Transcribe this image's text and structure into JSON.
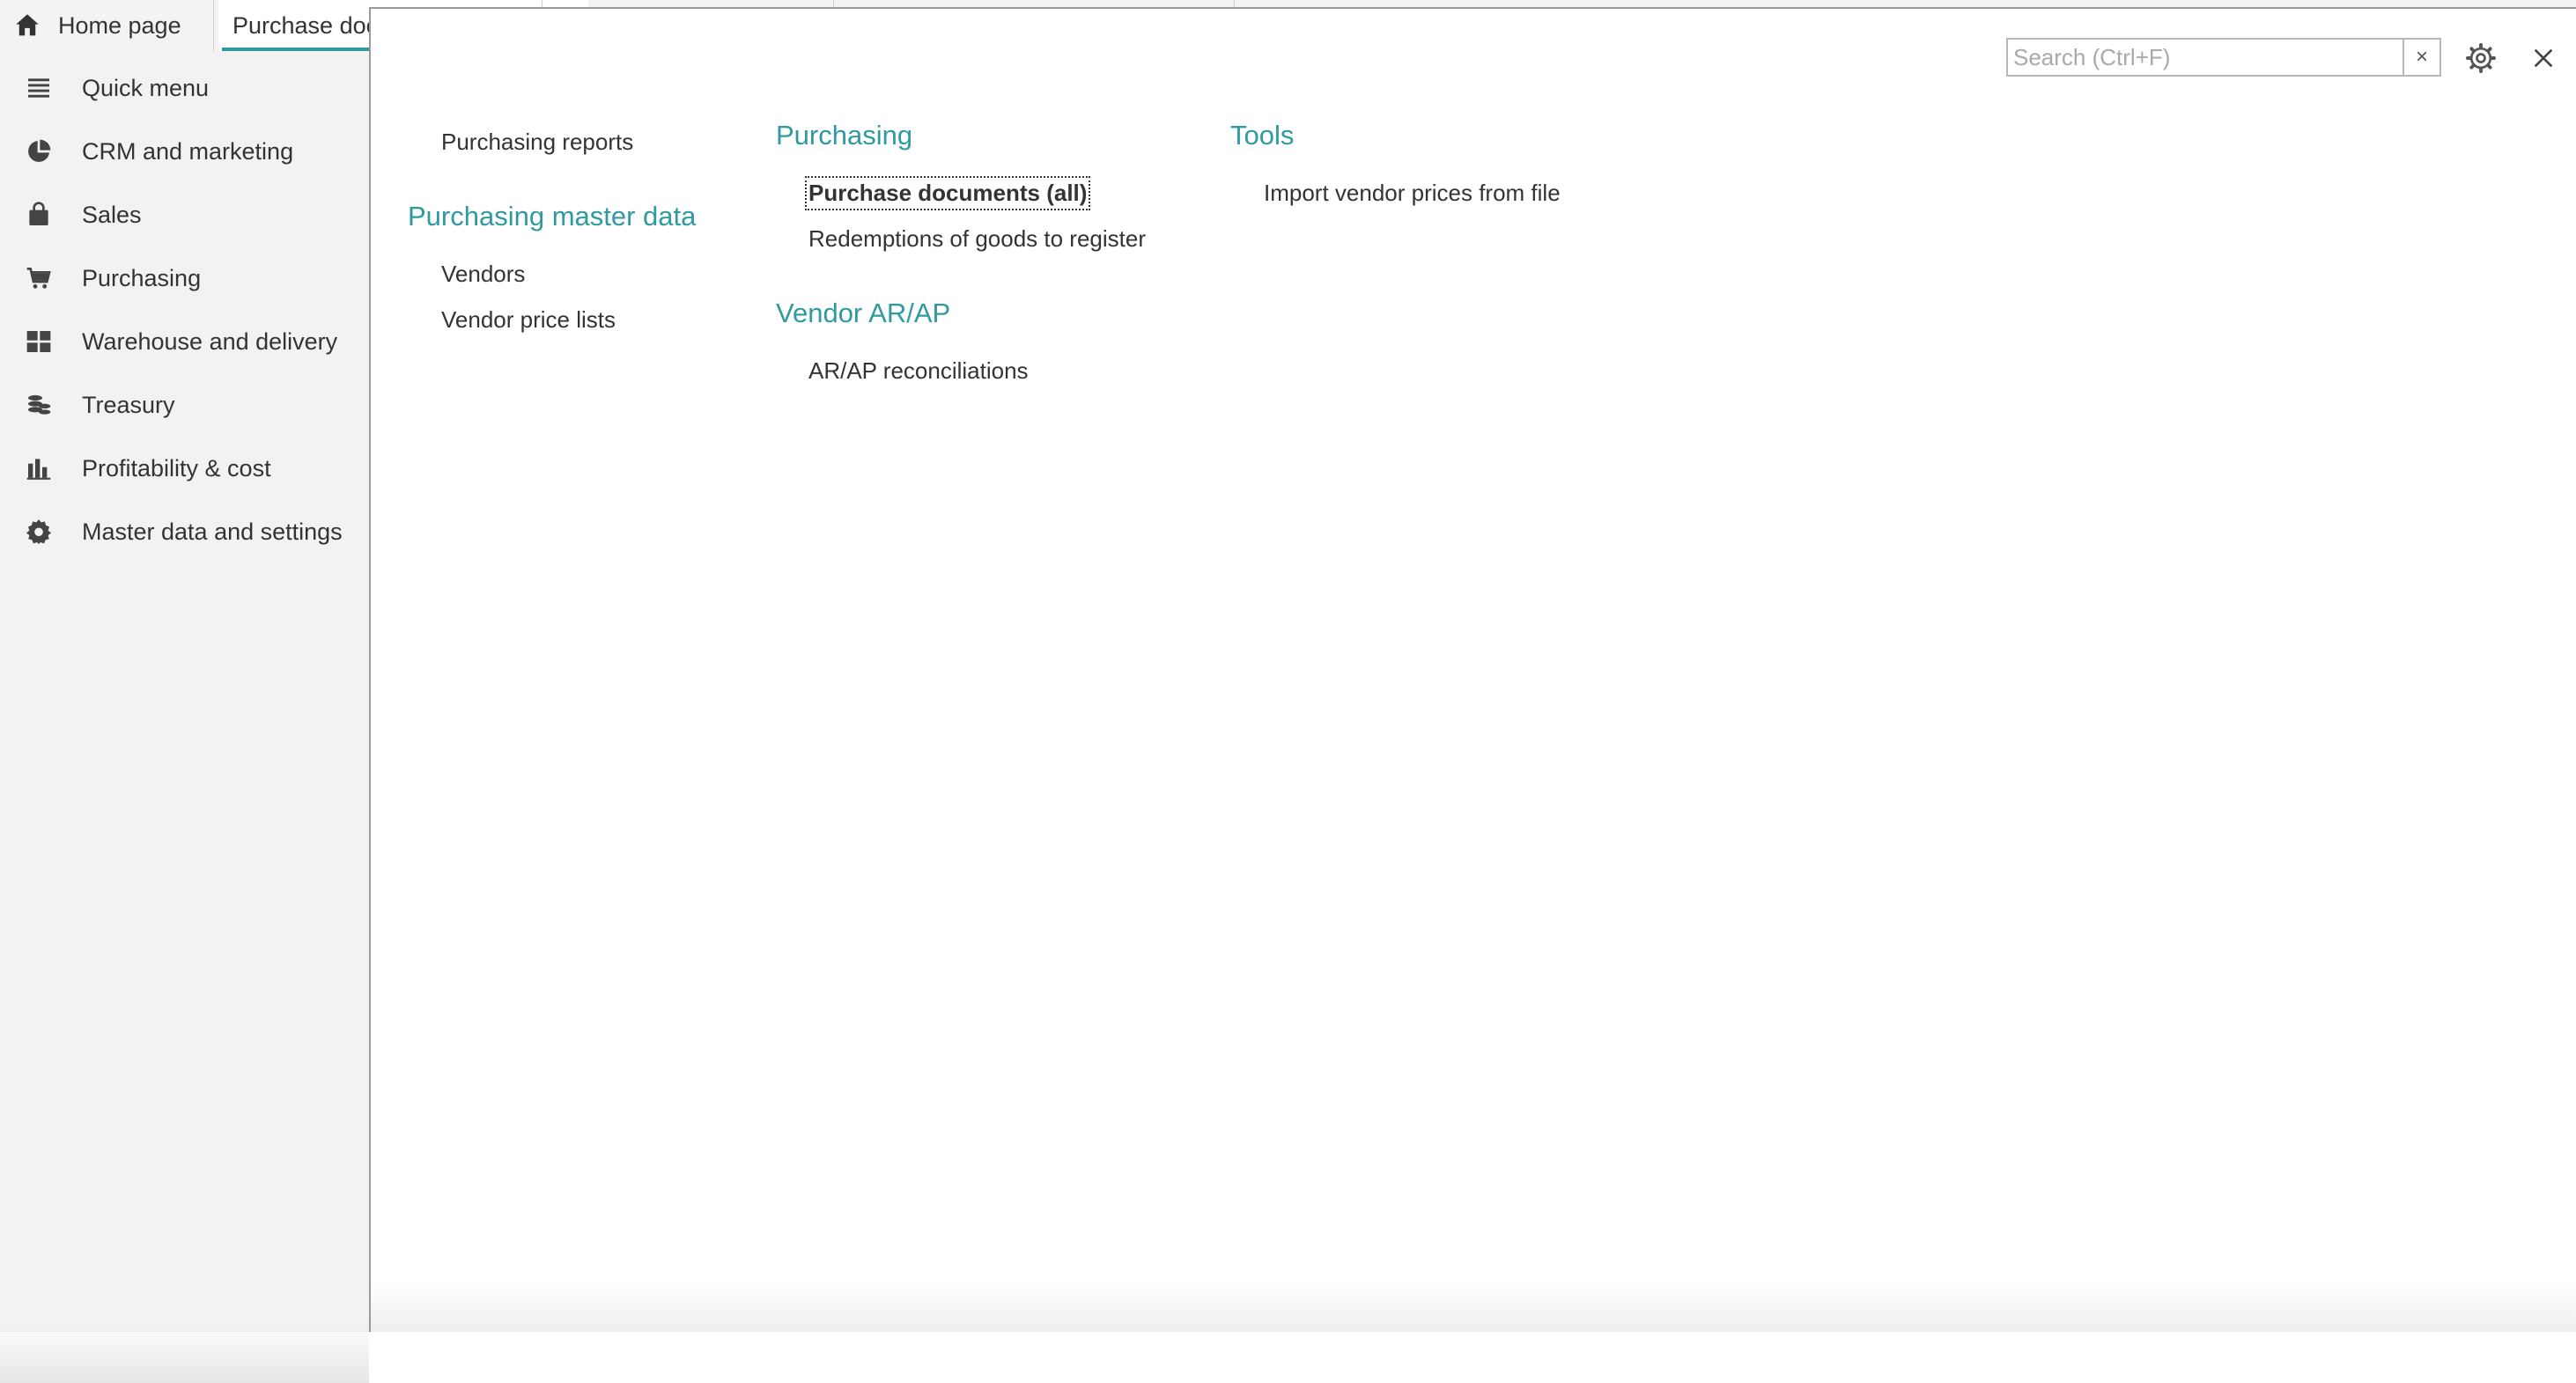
{
  "tabs": {
    "home_label": "Home page",
    "active_label": "Purchase documents (all)"
  },
  "sidebar": {
    "items": [
      {
        "label": "Quick menu",
        "icon": "list-icon"
      },
      {
        "label": "CRM and marketing",
        "icon": "pie-chart-icon"
      },
      {
        "label": "Sales",
        "icon": "shopping-bag-icon"
      },
      {
        "label": "Purchasing",
        "icon": "cart-icon"
      },
      {
        "label": "Warehouse and delivery",
        "icon": "grid-icon"
      },
      {
        "label": "Treasury",
        "icon": "coins-icon"
      },
      {
        "label": "Profitability & cost",
        "icon": "bar-chart-icon"
      },
      {
        "label": "Master data and settings",
        "icon": "gear-icon"
      }
    ]
  },
  "panel": {
    "search_placeholder": "Search (Ctrl+F)",
    "search_clear": "×",
    "col1": {
      "reports_link": "Purchasing reports",
      "master_heading": "Purchasing master data",
      "master_links": [
        "Vendors",
        "Vendor price lists"
      ]
    },
    "col2": {
      "purchasing_heading": "Purchasing",
      "purchasing_links": [
        "Purchase documents (all)",
        "Redemptions of goods to register"
      ],
      "arap_heading": "Vendor AR/AP",
      "arap_links": [
        "AR/AP reconciliations"
      ]
    },
    "col3": {
      "tools_heading": "Tools",
      "tools_links": [
        "Import vendor prices from file"
      ]
    }
  },
  "colors": {
    "accent": "#2f9aa0",
    "sidebar_bg": "#f2f2f2",
    "text": "#333333"
  }
}
